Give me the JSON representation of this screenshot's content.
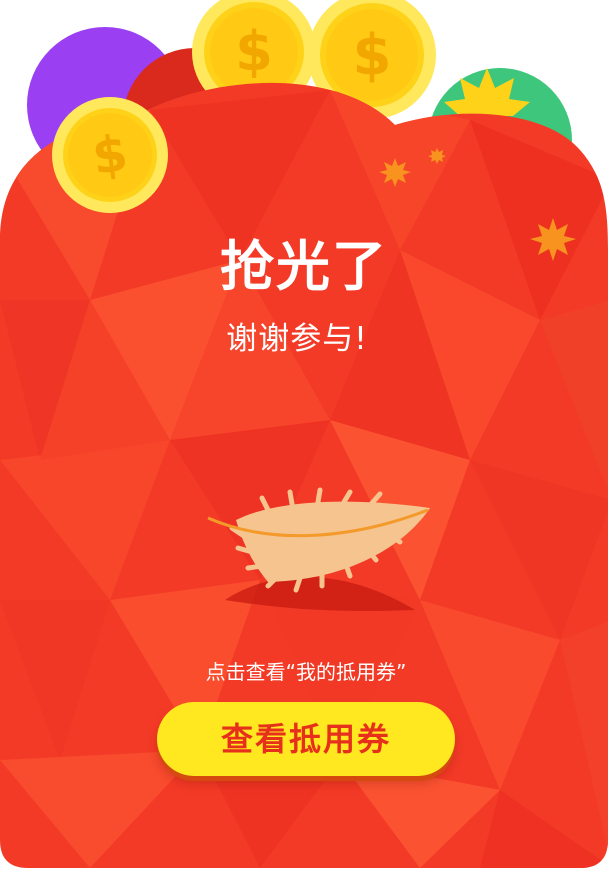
{
  "status": {
    "title": "抢光了",
    "subtitle": "谢谢参与!"
  },
  "hint": {
    "text": "点击查看“我的抵用券”"
  },
  "actions": {
    "view_coupons_label": "查看抵用券"
  },
  "coins": {
    "symbol": "$"
  },
  "colors": {
    "envelope_red": "#f33a26",
    "button_yellow": "#ffe81f",
    "button_text": "#e6301c",
    "coin_gold": "#ffd21a",
    "coin_rim": "#ffe85c",
    "purple_circle": "#9a3ff2",
    "green_circle": "#3ec77c",
    "feather": "#f6c48e"
  },
  "icons": {
    "decoration": [
      "coin-icon",
      "star-burst-icon",
      "feather-icon"
    ]
  }
}
